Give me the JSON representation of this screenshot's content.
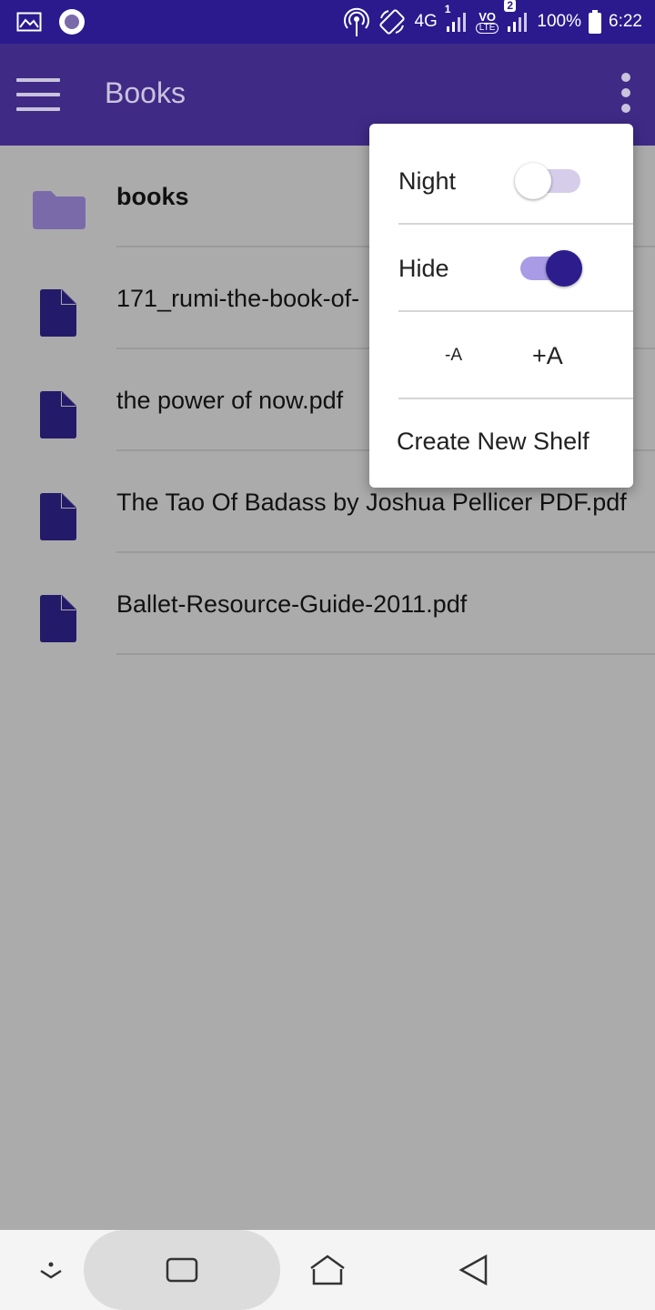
{
  "status_bar": {
    "network": "4G",
    "sim1": "1",
    "volte": "VO",
    "lte": "LTE",
    "sim2": "2",
    "battery": "100%",
    "time": "6:22",
    "icons": [
      "gallery-icon",
      "notification-circle-icon",
      "hotspot-icon",
      "rotate-icon",
      "signal-icon",
      "battery-icon"
    ]
  },
  "app_bar": {
    "title": "Books",
    "menu_icon": "hamburger-icon",
    "overflow_icon": "more-vert-icon"
  },
  "list": {
    "items": [
      {
        "type": "folder",
        "label": "books",
        "icon": "folder-icon"
      },
      {
        "type": "file",
        "label": "171_rumi-the-book-of-",
        "icon": "file-icon"
      },
      {
        "type": "file",
        "label": "the power of now.pdf",
        "icon": "file-icon"
      },
      {
        "type": "file",
        "label": "The Tao Of Badass by Joshua Pellicer PDF.pdf",
        "icon": "file-icon"
      },
      {
        "type": "file",
        "label": "Ballet-Resource-Guide-2011.pdf",
        "icon": "file-icon"
      }
    ]
  },
  "menu": {
    "night_label": "Night",
    "night_on": false,
    "hide_label": "Hide",
    "hide_on": true,
    "font_smaller": "-A",
    "font_larger": "+A",
    "create_shelf": "Create New Shelf"
  },
  "nav_bar": {
    "icons": [
      "chevron-down-icon",
      "recents-icon",
      "home-icon",
      "back-icon"
    ]
  },
  "colors": {
    "status_bar": "#2a1a8e",
    "app_bar": "#3f2a86",
    "accent": "#2c1c8c",
    "folder": "#7b6aaa",
    "file": "#241a6a",
    "scrim": "#ababab"
  }
}
